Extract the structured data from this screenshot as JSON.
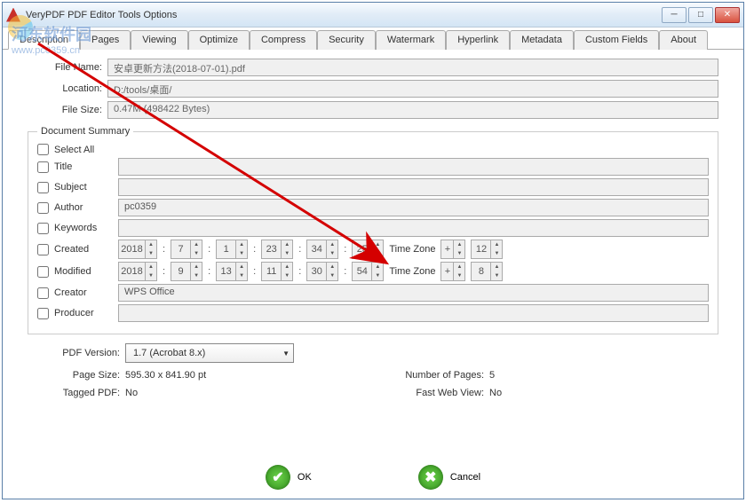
{
  "window": {
    "title": "VeryPDF PDF Editor Tools Options"
  },
  "tabs": [
    "Description",
    "Pages",
    "Viewing",
    "Optimize",
    "Compress",
    "Security",
    "Watermark",
    "Hyperlink",
    "Metadata",
    "Custom Fields",
    "About"
  ],
  "active_tab": 0,
  "basic": {
    "file_name_label": "File Name:",
    "file_name": "安卓更新方法(2018-07-01).pdf",
    "location_label": "Location:",
    "location": "D:/tools/桌面/",
    "file_size_label": "File Size:",
    "file_size": "0.47M  (498422 Bytes)"
  },
  "summary": {
    "legend": "Document Summary",
    "select_all": "Select All",
    "rows": [
      {
        "label": "Title",
        "value": ""
      },
      {
        "label": "Subject",
        "value": ""
      },
      {
        "label": "Author",
        "value": "pc0359"
      },
      {
        "label": "Keywords",
        "value": ""
      }
    ],
    "created_label": "Created",
    "created": {
      "year": "2018",
      "a": "7",
      "b": "1",
      "c": "23",
      "d": "34",
      "e": "25",
      "tz_sign": "+",
      "tz_val": "12"
    },
    "modified_label": "Modified",
    "modified": {
      "year": "2018",
      "a": "9",
      "b": "13",
      "c": "11",
      "d": "30",
      "e": "54",
      "tz_sign": "+",
      "tz_val": "8"
    },
    "timezone_label": "Time Zone",
    "creator_label": "Creator",
    "creator": "WPS Office",
    "producer_label": "Producer",
    "producer": ""
  },
  "props": {
    "pdf_version_label": "PDF Version:",
    "pdf_version": "1.7 (Acrobat 8.x)",
    "page_size_label": "Page Size:",
    "page_size": "595.30 x 841.90 pt",
    "num_pages_label": "Number of Pages:",
    "num_pages": "5",
    "tagged_label": "Tagged PDF:",
    "tagged": "No",
    "fast_label": "Fast Web View:",
    "fast": "No"
  },
  "footer": {
    "ok": "OK",
    "cancel": "Cancel"
  },
  "watermark": {
    "l1": "河东软件园",
    "l2": "www.pc0359.cn"
  }
}
